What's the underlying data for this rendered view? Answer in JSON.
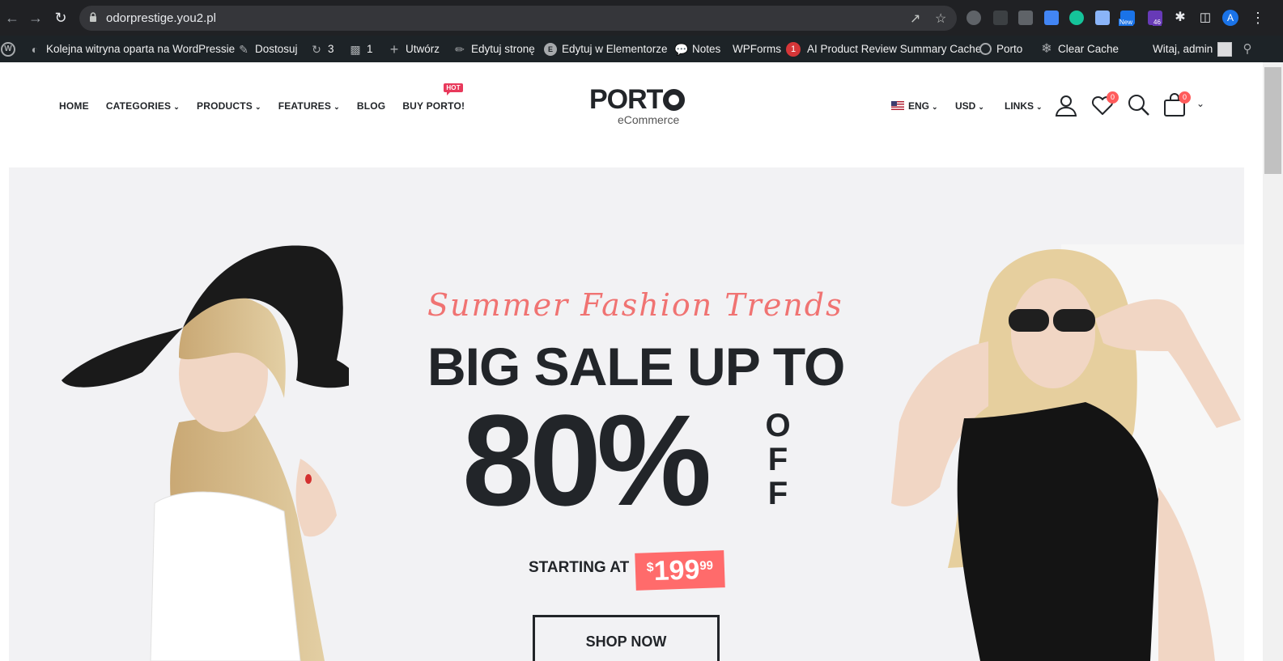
{
  "browser": {
    "url": "odorprestige.you2.pl",
    "profile_initial": "A",
    "extension_badge_new": "New",
    "extension_badge_count": "46"
  },
  "adminbar": {
    "site_name": "Kolejna witryna oparta na WordPressie",
    "customize": "Dostosuj",
    "updates_count": "3",
    "comments_count": "1",
    "create": "Utwórz",
    "edit_page": "Edytuj stronę",
    "edit_elementor": "Edytuj w Elementorze",
    "notes": "Notes",
    "wpforms": "WPForms",
    "wpforms_count": "1",
    "ai_cache": "AI Product Review Summary Cache",
    "porto": "Porto",
    "clear_cache": "Clear Cache",
    "greeting": "Witaj, admin"
  },
  "header": {
    "nav": [
      {
        "label": "HOME"
      },
      {
        "label": "CATEGORIES"
      },
      {
        "label": "PRODUCTS"
      },
      {
        "label": "FEATURES"
      },
      {
        "label": "BLOG"
      },
      {
        "label": "BUY PORTO!"
      }
    ],
    "hot_badge": "HOT",
    "logo_brand": "PORT",
    "logo_tagline": "eCommerce",
    "language": "ENG",
    "currency": "USD",
    "links": "LINKS",
    "wishlist_count": "0",
    "cart_count": "0"
  },
  "hero": {
    "script_title": "Summer Fashion Trends",
    "headline": "BIG SALE UP TO",
    "percent": "80%",
    "off_letters": [
      "O",
      "F",
      "F"
    ],
    "starting_label": "STARTING AT",
    "price_currency": "$",
    "price_main": "199",
    "price_cents": "99",
    "cta": "SHOP NOW"
  },
  "colors": {
    "accent": "#ff6b6b",
    "script": "#f07372",
    "hot": "#e8395b",
    "dark": "#222529",
    "admin_bar": "#1d2327",
    "hero_bg": "#f2f2f4"
  }
}
